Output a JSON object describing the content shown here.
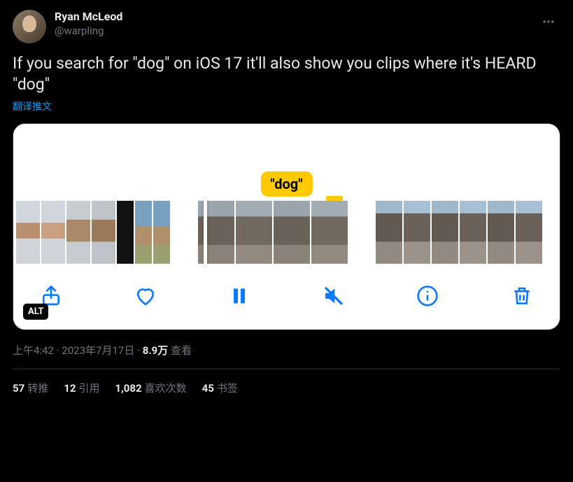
{
  "author": {
    "display_name": "Ryan McLeod",
    "handle": "@warpling"
  },
  "body_text": "If you search for \"dog\" on iOS 17 it'll also show you clips where it's HEARD \"dog\"",
  "translate_label": "翻译推文",
  "media": {
    "badge_text": "\"dog\"",
    "alt_label": "ALT"
  },
  "meta": {
    "time": "上午4:42",
    "date": "2023年7月17日",
    "views_num": "8.9万",
    "views_label": "查看"
  },
  "stats": {
    "retweets_num": "57",
    "retweets_label": "转推",
    "quotes_num": "12",
    "quotes_label": "引用",
    "likes_num": "1,082",
    "likes_label": "喜欢次数",
    "bookmarks_num": "45",
    "bookmarks_label": "书签"
  },
  "icons": {
    "share": "share-icon",
    "heart": "heart-icon",
    "pause": "pause-icon",
    "mute": "speaker-muted-icon",
    "info": "info-icon",
    "trash": "trash-icon"
  },
  "colors": {
    "accent": "#1d9bf0",
    "ios_blue": "#0a7aff",
    "badge_yellow": "#ffc900"
  }
}
